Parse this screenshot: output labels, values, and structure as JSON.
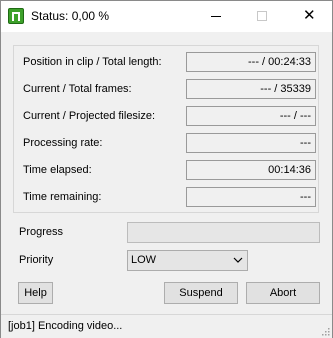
{
  "window": {
    "title": "Status: 0,00 %",
    "icon": "app-icon",
    "buttons": [
      "minimize-icon",
      "maximize-icon",
      "close-icon"
    ],
    "close_glyph": "✕"
  },
  "stats": [
    {
      "label": "Position in clip / Total length:",
      "value": "--- / 00:24:33"
    },
    {
      "label": "Current / Total frames:",
      "value": "--- / 35339"
    },
    {
      "label": "Current / Projected filesize:",
      "value": "--- / ---"
    },
    {
      "label": "Processing rate:",
      "value": "---"
    },
    {
      "label": "Time elapsed:",
      "value": "00:14:36"
    },
    {
      "label": "Time remaining:",
      "value": "---"
    }
  ],
  "progress": {
    "label": "Progress",
    "fraction": 0
  },
  "priority": {
    "label": "Priority",
    "selected": "LOW",
    "icon": "chevron-down-icon"
  },
  "buttons": {
    "help": "Help",
    "suspend": "Suspend",
    "abort": "Abort"
  },
  "statusbar": {
    "text": "[job1]   Encoding video..."
  },
  "colors": {
    "window_bg": "#f0f0f0",
    "titlebar_bg": "#ffffff",
    "progress_fill": "#06b025",
    "icon_green": "#3da12a"
  }
}
